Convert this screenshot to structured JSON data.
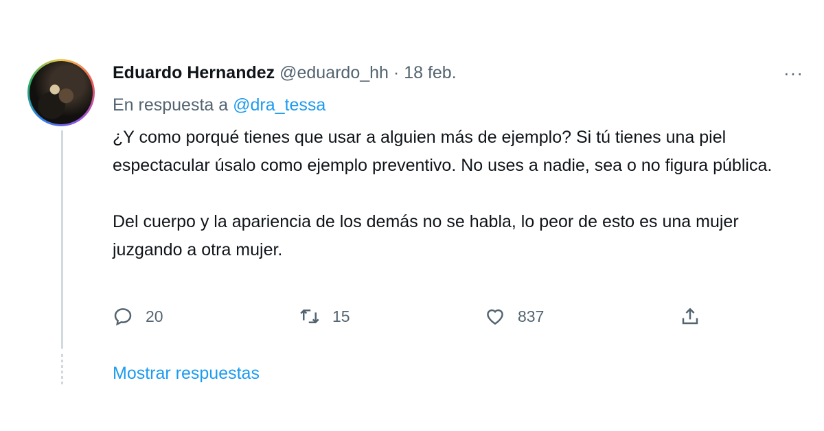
{
  "tweet": {
    "author_name": "Eduardo Hernandez",
    "author_handle": "@eduardo_hh",
    "separator": "·",
    "date": "18 feb.",
    "reply_prefix": "En respuesta a",
    "reply_mention": "@dra_tessa",
    "paragraphs": [
      "¿Y como porqué tienes que usar a alguien más de ejemplo? Si tú tienes una piel espectacular úsalo como ejemplo preventivo. No uses a nadie, sea o no figura pública.",
      "Del cuerpo y la apariencia de los demás no se habla, lo peor de esto es una mujer juzgando a otra mujer."
    ],
    "more_icon": "more-horizontal-icon",
    "more_glyph": "···"
  },
  "actions": {
    "reply": {
      "icon": "reply-icon",
      "count": "20"
    },
    "retweet": {
      "icon": "retweet-icon",
      "count": "15"
    },
    "like": {
      "icon": "heart-icon",
      "count": "837"
    },
    "share": {
      "icon": "share-icon"
    }
  },
  "show_replies_label": "Mostrar respuestas",
  "colors": {
    "link": "#1d9bf0",
    "muted": "#536471",
    "text": "#0f1419",
    "thread_line": "#cfd9de"
  }
}
